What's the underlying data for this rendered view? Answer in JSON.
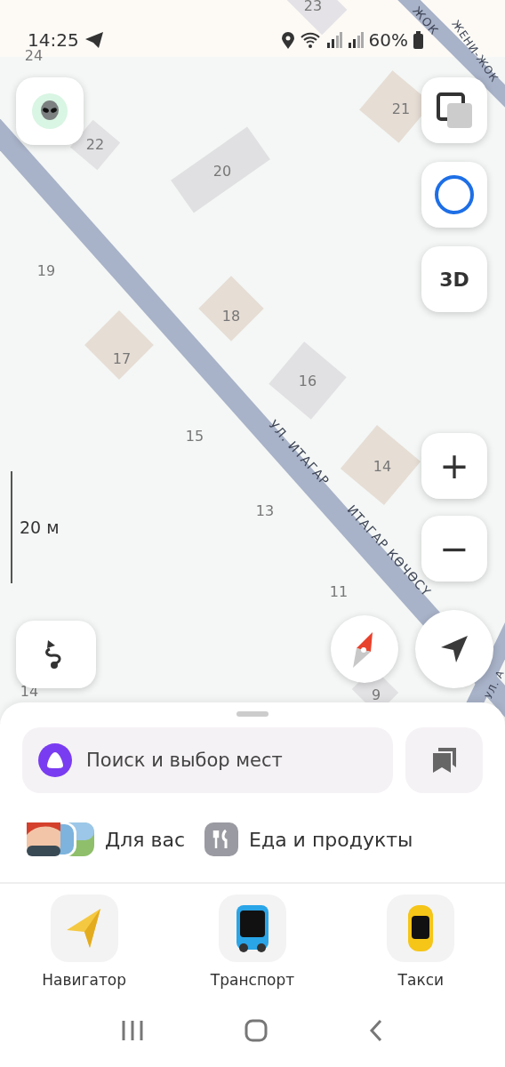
{
  "status_bar": {
    "time": "14:25",
    "battery": "60%"
  },
  "map": {
    "buildings": [
      {
        "label": "23"
      },
      {
        "label": "22"
      },
      {
        "label": "20"
      },
      {
        "label": "21"
      },
      {
        "label": "18"
      },
      {
        "label": "17"
      },
      {
        "label": "16"
      },
      {
        "label": "14"
      },
      {
        "label": "9"
      }
    ],
    "numbers": [
      "24",
      "19",
      "15",
      "13",
      "11",
      "14"
    ],
    "streets": [
      "ЖОК",
      "ЖЕНИ-ЖОК",
      "УЛ. ИТАГАР",
      "ИТАГАР КӨЧӨСҮ",
      "УЛ. А"
    ],
    "scale": "20 м"
  },
  "controls": {
    "view_3d": "3D",
    "zoom_in": "+",
    "zoom_out": "−"
  },
  "search": {
    "placeholder": "Поиск и выбор мест"
  },
  "categories": [
    {
      "label": "Для вас",
      "kind": "photos"
    },
    {
      "label": "Еда и продукты",
      "kind": "food"
    }
  ],
  "apps": [
    {
      "label": "Навигатор",
      "kind": "navigator"
    },
    {
      "label": "Транспорт",
      "kind": "transport"
    },
    {
      "label": "Такси",
      "kind": "taxi"
    }
  ]
}
